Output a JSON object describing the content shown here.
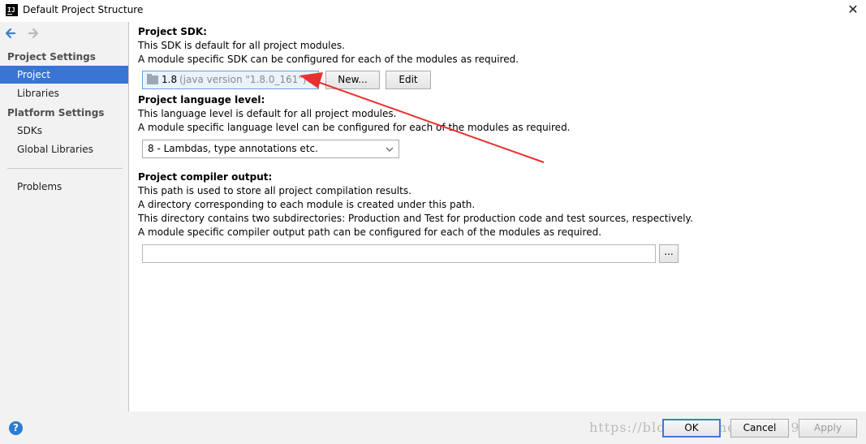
{
  "window": {
    "title": "Default Project Structure",
    "app_icon_text": "IJ",
    "close_glyph": "✕"
  },
  "sidebar": {
    "project_settings_header": "Project Settings",
    "platform_settings_header": "Platform Settings",
    "items": [
      {
        "label": "Project",
        "selected": true
      },
      {
        "label": "Libraries",
        "selected": false
      },
      {
        "label": "SDKs",
        "selected": false
      },
      {
        "label": "Global Libraries",
        "selected": false
      },
      {
        "label": "Problems",
        "selected": false
      }
    ]
  },
  "sdk": {
    "heading": "Project SDK:",
    "line1": "This SDK is default for all project modules.",
    "line2": "A module specific SDK can be configured for each of the modules as required.",
    "selected_version": "1.8",
    "selected_detail": "(java version \"1.8.0_161\")",
    "new_button": "New...",
    "edit_button": "Edit"
  },
  "language": {
    "heading": "Project language level:",
    "line1": "This language level is default for all project modules.",
    "line2": "A module specific language level can be configured for each of the modules as required.",
    "selected": "8 - Lambdas, type annotations etc."
  },
  "compiler": {
    "heading": "Project compiler output:",
    "line1": "This path is used to store all project compilation results.",
    "line2": "A directory corresponding to each module is created under this path.",
    "line3": "This directory contains two subdirectories: Production and Test for production code and test sources, respectively.",
    "line4": "A module specific compiler output path can be configured for each of the modules as required.",
    "output_path": "",
    "browse_button": "..."
  },
  "footer": {
    "help_glyph": "?",
    "ok_button": "OK",
    "cancel_button": "Cancel",
    "apply_button": "Apply",
    "watermark": "https://blog.csdn.net/qq_26941833"
  },
  "annotation": {
    "arrow_color": "#e8322f"
  }
}
